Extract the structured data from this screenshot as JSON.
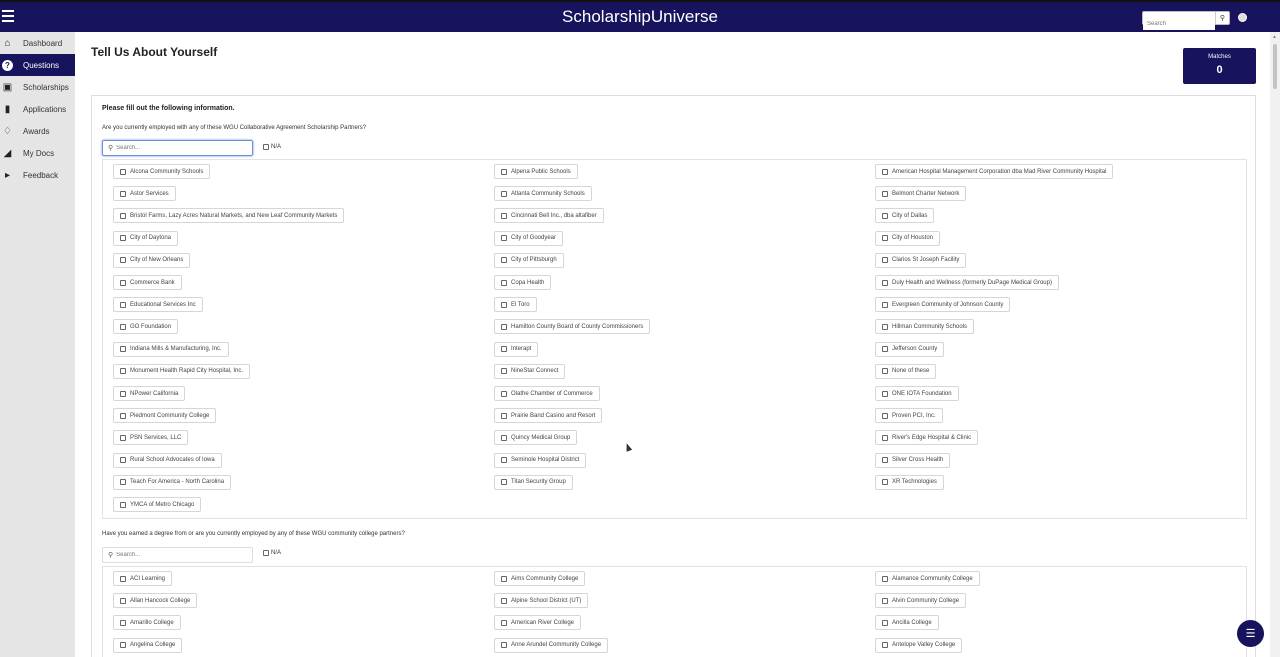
{
  "app": {
    "title": "ScholarshipUniverse",
    "search_placeholder": "Search"
  },
  "sidebar": {
    "items": [
      {
        "label": "Dashboard",
        "icon": "home-icon",
        "active": false
      },
      {
        "label": "Questions",
        "icon": "question-icon",
        "active": true
      },
      {
        "label": "Scholarships",
        "icon": "money-icon",
        "active": false
      },
      {
        "label": "Applications",
        "icon": "document-icon",
        "active": false
      },
      {
        "label": "Awards",
        "icon": "trophy-icon",
        "active": false
      },
      {
        "label": "My Docs",
        "icon": "folder-icon",
        "active": false
      },
      {
        "label": "Feedback",
        "icon": "megaphone-icon",
        "active": false
      }
    ]
  },
  "page": {
    "title": "Tell Us About Yourself",
    "matches_label": "Matches",
    "matches_value": "0",
    "intro": "Please fill out the following information."
  },
  "questions": [
    {
      "text": "Are you currently employed with any of these WGU Collaborative Agreement Scholarship Partners?",
      "search_placeholder": "Search...",
      "na_label": "N/A",
      "options": [
        "Alcona Community Schools",
        "Alpena Public Schools",
        "American Hospital Management Corporation dba Mad River Community Hospital",
        "Astor Services",
        "Atlanta Community Schools",
        "Belmont Charter Network",
        "Bristol Farms, Lazy Acres Natural Markets, and New Leaf Community Markets",
        "Cincinnati Bell Inc., dba altafiber",
        "City of Dallas",
        "City of Daytona",
        "City of Goodyear",
        "City of Houston",
        "City of New Orleans",
        "City of Pittsburgh",
        "Clarios St Joseph Facility",
        "Commerce Bank",
        "Copa Health",
        "Duly Health and Wellness (formerly DuPage Medical Group)",
        "Educational Services Inc",
        "El Toro",
        "Evergreen Community of Johnson County",
        "GO Foundation",
        "Hamilton County Board of County Commissioners",
        "Hillman Community Schools",
        "Indiana Mills & Manufacturing, Inc.",
        "Interapt",
        "Jefferson County",
        "Monument Health Rapid City Hospital, Inc.",
        "NineStar Connect",
        "None of these",
        "NPower California",
        "Olathe Chamber of Commerce",
        "ONE IOTA Foundation",
        "Piedmont Community College",
        "Prairie Band Casino and Resort",
        "Proven PCI, Inc.",
        "PSN Services, LLC",
        "Quincy Medical Group",
        "River's Edge Hospital & Clinic",
        "Rural School Advocates of Iowa",
        "Seminole Hospital District",
        "Silver Cross Health",
        "Teach For America - North Carolina",
        "Titan Security Group",
        "XR Technologies",
        "YMCA of Metro Chicago"
      ]
    },
    {
      "text": "Have you earned a degree from or are you currently employed by any of these WGU community college partners?",
      "search_placeholder": "Search...",
      "na_label": "N/A",
      "options": [
        "ACI Learning",
        "Aims Community College",
        "Alamance Community College",
        "Allan Hancock College",
        "Alpine School District (UT)",
        "Alvin Community College",
        "Amarillo College",
        "American River College",
        "Ancilla College",
        "Angelina College",
        "Anne Arundel Community College",
        "Antelope Valley College"
      ]
    }
  ]
}
